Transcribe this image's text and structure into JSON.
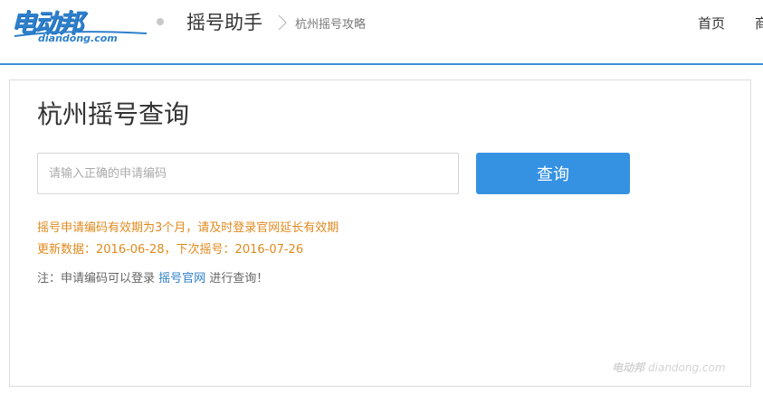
{
  "header": {
    "logo_text": "电动邦",
    "logo_domain": "diandong.com",
    "section_title": "摇号助手",
    "breadcrumb_link": "杭州摇号攻略",
    "nav": {
      "home": "首页",
      "next_partial": "商"
    }
  },
  "main": {
    "title": "杭州摇号查询",
    "input": {
      "placeholder": "请输入正确的申请编码",
      "value": ""
    },
    "query_button": "查询",
    "notice_validity": "摇号申请编码有效期为3个月，请及时登录官网延长有效期",
    "notice_dates": "更新数据：2016-06-28，下次摇号：2016-07-26",
    "footnote": {
      "prefix": "注：申请编码可以登录 ",
      "link": "摇号官网",
      "suffix": " 进行查询！"
    }
  },
  "watermark": {
    "text": "电动邦",
    "domain": "diandong.com"
  },
  "colors": {
    "accent": "#3591e2",
    "header_rule": "#3c8fd6",
    "notice": "#e08a1e",
    "link": "#2f7fc8"
  }
}
